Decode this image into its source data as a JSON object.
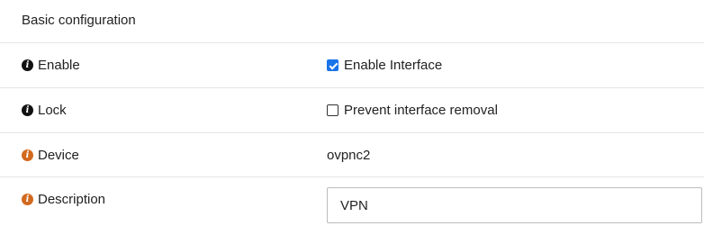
{
  "section": {
    "title": "Basic configuration"
  },
  "rows": {
    "enable": {
      "label": "Enable",
      "checkbox_label": "Enable Interface",
      "checked": true
    },
    "lock": {
      "label": "Lock",
      "checkbox_label": "Prevent interface removal",
      "checked": false
    },
    "device": {
      "label": "Device",
      "value": "ovpnc2"
    },
    "description": {
      "label": "Description",
      "value": "VPN"
    }
  },
  "colors": {
    "info_icon_dark": "#111111",
    "info_icon_orange": "#d2691e",
    "checkbox_checked": "#1a73e8"
  },
  "icons": {
    "info": "info-circle-icon"
  }
}
